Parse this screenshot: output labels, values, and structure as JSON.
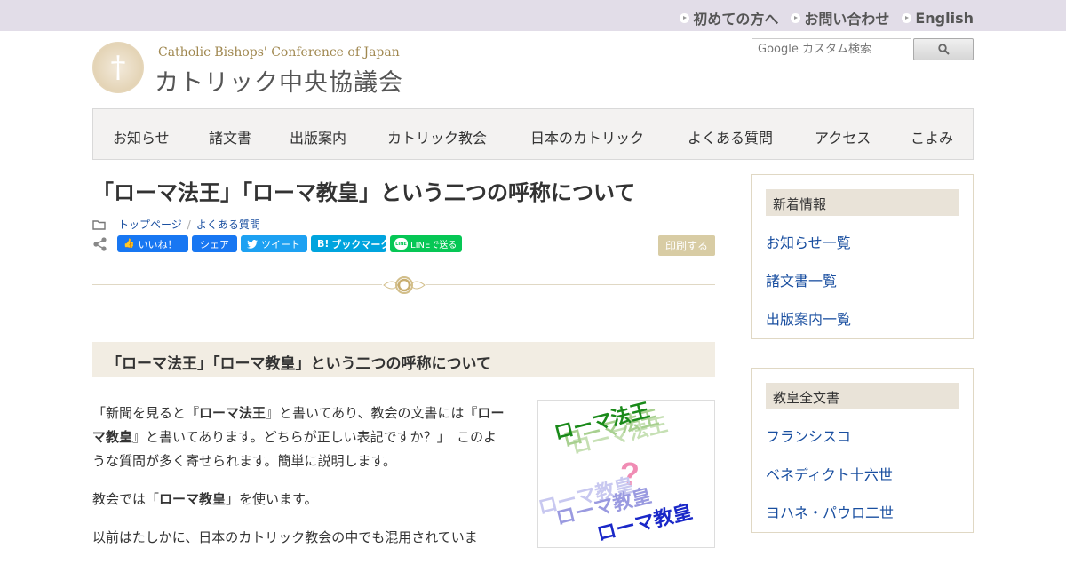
{
  "topbar": {
    "links": [
      "初めての方へ",
      "お問い合わせ",
      "English"
    ]
  },
  "logo": {
    "symbol": "†",
    "en": "Catholic Bishops' Conference of Japan",
    "ja": "カトリック中央協議会"
  },
  "search": {
    "placeholder": "Google カスタム検索",
    "button_icon": "search-icon"
  },
  "nav": {
    "items": [
      "お知らせ",
      "諸文書",
      "出版案内",
      "カトリック教会",
      "日本のカトリック",
      "よくある質問",
      "アクセス",
      "こよみ"
    ]
  },
  "article": {
    "title": "「ローマ法王」「ローマ教皇」という二つの呼称について",
    "breadcrumb": [
      "トップページ",
      "よくある質問"
    ],
    "share": {
      "like": "いいね！",
      "share": "シェア",
      "tweet": "ツイート",
      "bookmark": "ブックマーク",
      "line": "LINEで送る"
    },
    "print_label": "印刷する",
    "heading": "「ローマ法王」「ローマ教皇」という二つの呼称について",
    "p1_a": "「新聞を見ると『",
    "p1_b1": "ローマ法王",
    "p1_c": "』と書いてあり、教会の文書には『",
    "p1_b2": "ローマ教皇",
    "p1_d": "』と書いてあります。どちらが正しい表記ですか？」　このような質問が多く寄せられます。簡単に説明します。",
    "p2_a": "教会では「",
    "p2_b": "ローマ教皇",
    "p2_c": "」を使います。",
    "p3": "以前はたしかに、日本のカトリック教会の中でも混用されていま",
    "figure": {
      "top_text": "ローマ法王",
      "mid_text": "?",
      "bottom_text": "ローマ教皇"
    }
  },
  "sidebar": {
    "boxes": [
      {
        "title": "新着情報",
        "links": [
          "お知らせ一覧",
          "諸文書一覧",
          "出版案内一覧"
        ]
      },
      {
        "title": "教皇全文書",
        "links": [
          "フランシスコ",
          "ベネディクト十六世",
          "ヨハネ・パウロ二世"
        ]
      }
    ]
  },
  "colors": {
    "topbar": "#e2dde8",
    "link": "#1a4fa0",
    "facebook": "#1877f2",
    "twitter": "#1da1f2",
    "hatena": "#00a4de",
    "line": "#06c755",
    "print": "#d8cca4"
  }
}
